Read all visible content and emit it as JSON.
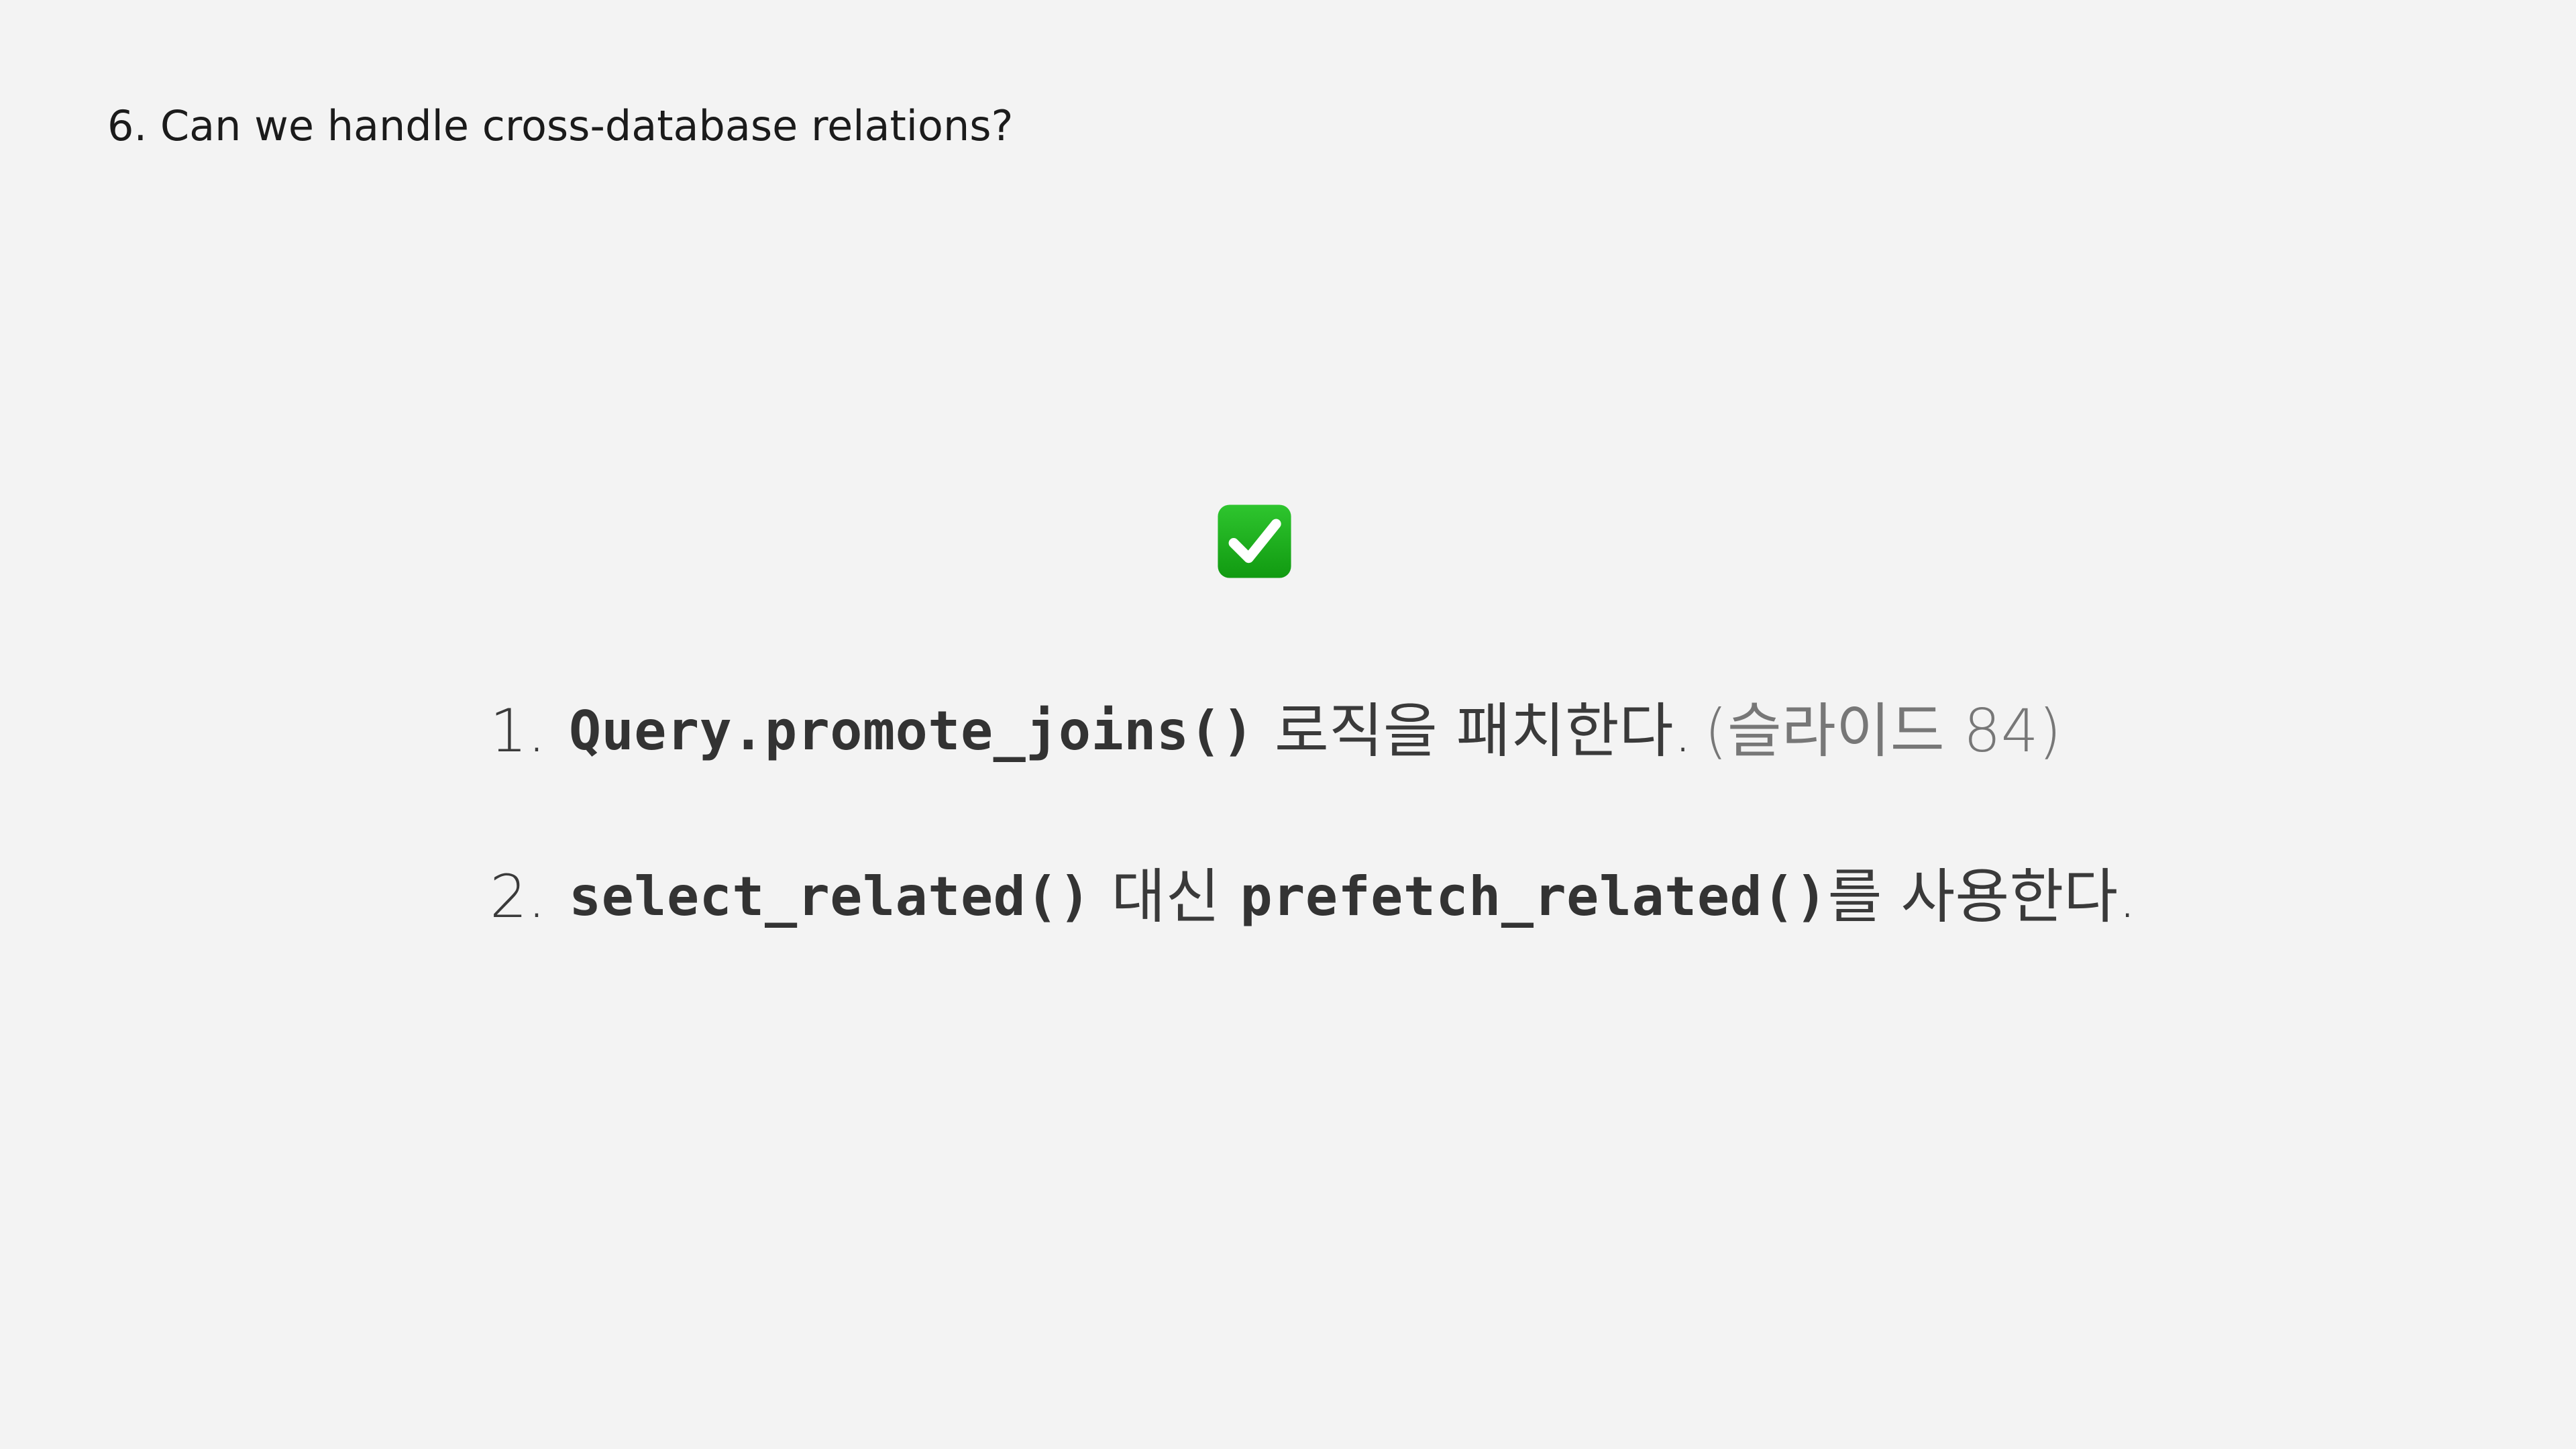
{
  "slide": {
    "title": "6. Can we handle cross-database relations?"
  },
  "icons": {
    "check": "check-mark-icon",
    "check_bg": "#18a418",
    "check_mark": "#ffffff"
  },
  "items": [
    {
      "number": "1.",
      "code": "Query.promote_joins()",
      "text": "로직을 패치한다.",
      "note": "(슬라이드 84)"
    },
    {
      "number": "2.",
      "code_1": "select_related()",
      "text_1": "대신",
      "code_2": "prefetch_related()",
      "text_2": "를 사용한다."
    }
  ]
}
